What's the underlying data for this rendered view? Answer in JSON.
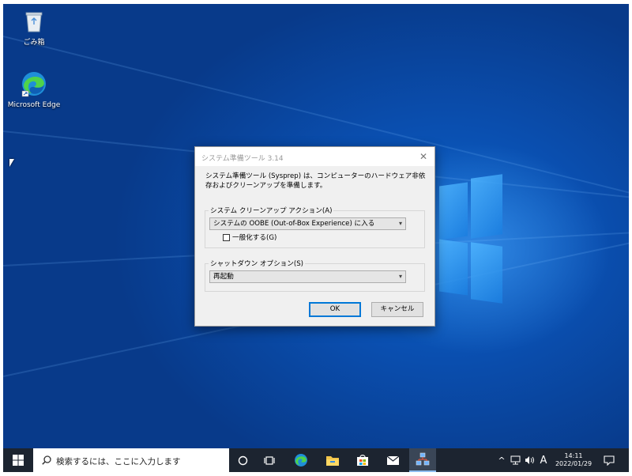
{
  "desktop": {
    "icons": [
      {
        "label": "ごみ箱",
        "icon": "recycle-bin-icon"
      },
      {
        "label": "Microsoft Edge",
        "icon": "edge-icon"
      }
    ]
  },
  "dialog": {
    "title": "システム準備ツール 3.14",
    "description": "システム準備ツール (Sysprep) は、コンピューターのハードウェア非依存およびクリーンアップを準備します。",
    "cleanup_group_label": "システム クリーンアップ アクション(A)",
    "cleanup_selected": "システムの OOBE (Out-of-Box Experience) に入る",
    "generalize_label": "一般化する(G)",
    "generalize_checked": false,
    "shutdown_group_label": "シャットダウン オプション(S)",
    "shutdown_selected": "再起動",
    "ok_label": "OK",
    "cancel_label": "キャンセル",
    "close_glyph": "✕"
  },
  "taskbar": {
    "search_placeholder": "検索するには、ここに入力します",
    "ime_mode": "A",
    "time": "14:11",
    "date": "2022/01/29",
    "accent": "#0078d7"
  }
}
